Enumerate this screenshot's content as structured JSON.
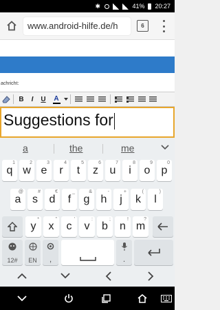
{
  "status_bar": {
    "battery": "41%",
    "time": "20:27"
  },
  "browser": {
    "url": "www.android-hilfe.de/h",
    "tab_count": "6"
  },
  "page": {
    "field_label": "achricht:"
  },
  "editor": {
    "text": "Suggestions for"
  },
  "toolbar": {
    "items": [
      "B",
      "I",
      "U",
      "A"
    ]
  },
  "keyboard": {
    "suggestions": [
      "a",
      "the",
      "me"
    ],
    "row1": [
      {
        "k": "q",
        "h": "1"
      },
      {
        "k": "w",
        "h": "2"
      },
      {
        "k": "e",
        "h": "3"
      },
      {
        "k": "r",
        "h": "4"
      },
      {
        "k": "t",
        "h": "5"
      },
      {
        "k": "z",
        "h": "6"
      },
      {
        "k": "u",
        "h": "7"
      },
      {
        "k": "i",
        "h": "8"
      },
      {
        "k": "o",
        "h": "9"
      },
      {
        "k": "p",
        "h": "0"
      }
    ],
    "row2": [
      {
        "k": "a",
        "h": "@"
      },
      {
        "k": "s",
        "h": "#"
      },
      {
        "k": "d",
        "h": "€"
      },
      {
        "k": "f",
        "h": "_"
      },
      {
        "k": "g",
        "h": "&"
      },
      {
        "k": "h",
        "h": "-"
      },
      {
        "k": "j",
        "h": "+"
      },
      {
        "k": "k",
        "h": "("
      },
      {
        "k": "l",
        "h": ")"
      }
    ],
    "row3": [
      {
        "k": "y",
        "h": "*"
      },
      {
        "k": "x",
        "h": "\""
      },
      {
        "k": "c",
        "h": "'"
      },
      {
        "k": "v",
        "h": ":"
      },
      {
        "k": "b",
        "h": ";"
      },
      {
        "k": "n",
        "h": "!"
      },
      {
        "k": "m",
        "h": "?"
      }
    ],
    "row1_hints_top": [
      "1",
      "2",
      "3",
      "4",
      "5",
      "6",
      "7",
      "8",
      "9",
      "0"
    ],
    "row2_hints_top": [
      "!",
      "@",
      "#",
      "$",
      "%",
      "&",
      "*",
      "+",
      "/"
    ],
    "symbols_label": "12#",
    "language_label": "EN",
    "comma_label": ",",
    "period_label": "."
  }
}
